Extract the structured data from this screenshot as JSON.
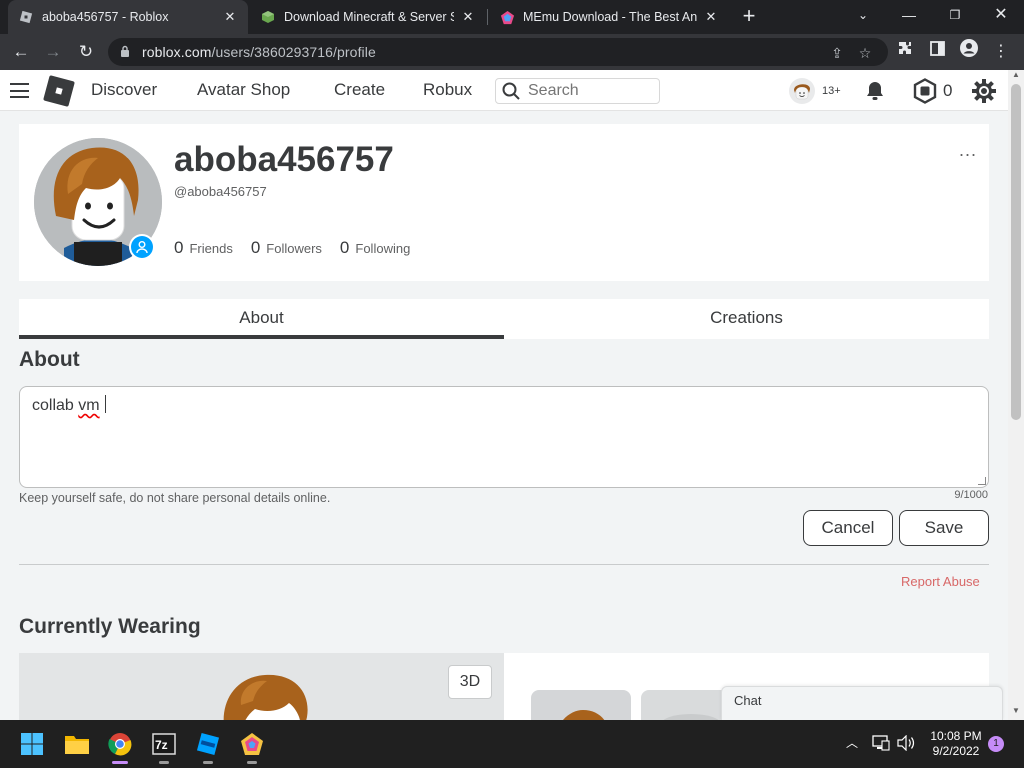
{
  "browser": {
    "tabs": [
      {
        "title": "aboba456757 - Roblox",
        "active": true
      },
      {
        "title": "Download Minecraft & Server Sof",
        "active": false
      },
      {
        "title": "MEmu Download - The Best Andr",
        "active": false
      }
    ],
    "url_host": "roblox.com",
    "url_path": "/users/3860293716/profile"
  },
  "header": {
    "nav": [
      "Discover",
      "Avatar Shop",
      "Create",
      "Robux"
    ],
    "search_placeholder": "Search",
    "age_badge": "13+",
    "robux_balance": "0"
  },
  "profile": {
    "display_name": "aboba456757",
    "username": "@aboba456757",
    "friends_count": "0",
    "friends_label": "Friends",
    "followers_count": "0",
    "followers_label": "Followers",
    "following_count": "0",
    "following_label": "Following",
    "more_icon": "..."
  },
  "tabs": {
    "about": "About",
    "creations": "Creations",
    "active": "About"
  },
  "about": {
    "heading": "About",
    "word1": "collab",
    "word2": "vm",
    "safety_note": "Keep yourself safe, do not share personal details online.",
    "char_count": "9/1000",
    "cancel_label": "Cancel",
    "save_label": "Save",
    "report_label": "Report Abuse"
  },
  "wearing": {
    "heading": "Currently Wearing",
    "btn_3d": "3D"
  },
  "chat": {
    "label": "Chat"
  },
  "taskbar": {
    "time": "10:08 PM",
    "date": "9/2/2022",
    "notification_count": "1",
    "apps": [
      "start-icon",
      "file-explorer-icon",
      "chrome-icon",
      "7zip-icon",
      "roblox-studio-icon",
      "memu-icon"
    ]
  },
  "colors": {
    "accent_blue": "#00a2ff",
    "report_red": "#d86868",
    "taskbar_active": "#c68cf7"
  }
}
